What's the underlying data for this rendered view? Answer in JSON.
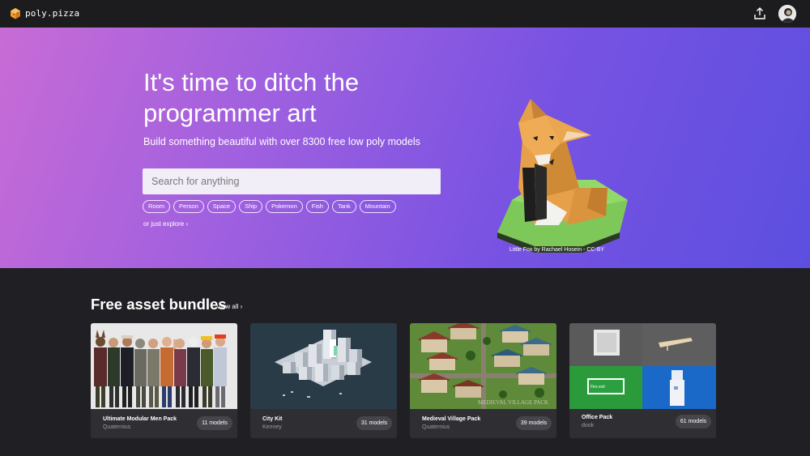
{
  "brand": {
    "name": "poly.pizza"
  },
  "header": {
    "upload_icon": "upload-icon",
    "avatar_icon": "user-avatar"
  },
  "hero": {
    "title_line1": "It's time to ditch the",
    "title_line2": "programmer art",
    "subtitle": "Build something beautiful with over 8300 free low poly models",
    "search_placeholder": "Search for anything",
    "tags": [
      "Room",
      "Person",
      "Space",
      "Ship",
      "Pokemon",
      "Fish",
      "Tank",
      "Mountain"
    ],
    "explore_label": "or just explore ›",
    "credit": "Little Fox by Rachael Hosein - CC-BY",
    "gradient_colors": [
      "#c86bd6",
      "#9c5fe0",
      "#7752e2",
      "#5c4fe0"
    ]
  },
  "bundles": {
    "title": "Free asset bundles",
    "view_all_label": "View all ›",
    "cards": [
      {
        "title": "Ultimate Modular Men Pack",
        "author": "Quaternius",
        "count": "11 models"
      },
      {
        "title": "City Kit",
        "author": "Kenney",
        "count": "31 models"
      },
      {
        "title": "Medieval Village Pack",
        "author": "Quaternius",
        "count": "39 models",
        "watermark": "MEDIEVAL VILLAGE PACK"
      },
      {
        "title": "Office Pack",
        "author": "dook",
        "count": "61 models",
        "sign_text": "Fire exit"
      }
    ]
  }
}
